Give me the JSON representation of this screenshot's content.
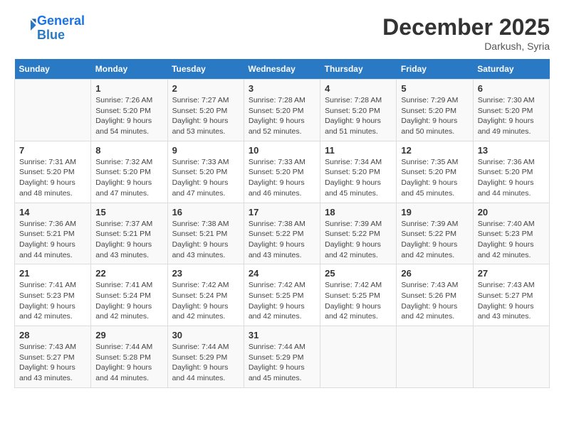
{
  "header": {
    "logo_line1": "General",
    "logo_line2": "Blue",
    "month_title": "December 2025",
    "location": "Darkush, Syria"
  },
  "calendar": {
    "weekdays": [
      "Sunday",
      "Monday",
      "Tuesday",
      "Wednesday",
      "Thursday",
      "Friday",
      "Saturday"
    ],
    "weeks": [
      [
        {
          "day": "",
          "info": ""
        },
        {
          "day": "1",
          "info": "Sunrise: 7:26 AM\nSunset: 5:20 PM\nDaylight: 9 hours\nand 54 minutes."
        },
        {
          "day": "2",
          "info": "Sunrise: 7:27 AM\nSunset: 5:20 PM\nDaylight: 9 hours\nand 53 minutes."
        },
        {
          "day": "3",
          "info": "Sunrise: 7:28 AM\nSunset: 5:20 PM\nDaylight: 9 hours\nand 52 minutes."
        },
        {
          "day": "4",
          "info": "Sunrise: 7:28 AM\nSunset: 5:20 PM\nDaylight: 9 hours\nand 51 minutes."
        },
        {
          "day": "5",
          "info": "Sunrise: 7:29 AM\nSunset: 5:20 PM\nDaylight: 9 hours\nand 50 minutes."
        },
        {
          "day": "6",
          "info": "Sunrise: 7:30 AM\nSunset: 5:20 PM\nDaylight: 9 hours\nand 49 minutes."
        }
      ],
      [
        {
          "day": "7",
          "info": "Sunrise: 7:31 AM\nSunset: 5:20 PM\nDaylight: 9 hours\nand 48 minutes."
        },
        {
          "day": "8",
          "info": "Sunrise: 7:32 AM\nSunset: 5:20 PM\nDaylight: 9 hours\nand 47 minutes."
        },
        {
          "day": "9",
          "info": "Sunrise: 7:33 AM\nSunset: 5:20 PM\nDaylight: 9 hours\nand 47 minutes."
        },
        {
          "day": "10",
          "info": "Sunrise: 7:33 AM\nSunset: 5:20 PM\nDaylight: 9 hours\nand 46 minutes."
        },
        {
          "day": "11",
          "info": "Sunrise: 7:34 AM\nSunset: 5:20 PM\nDaylight: 9 hours\nand 45 minutes."
        },
        {
          "day": "12",
          "info": "Sunrise: 7:35 AM\nSunset: 5:20 PM\nDaylight: 9 hours\nand 45 minutes."
        },
        {
          "day": "13",
          "info": "Sunrise: 7:36 AM\nSunset: 5:20 PM\nDaylight: 9 hours\nand 44 minutes."
        }
      ],
      [
        {
          "day": "14",
          "info": "Sunrise: 7:36 AM\nSunset: 5:21 PM\nDaylight: 9 hours\nand 44 minutes."
        },
        {
          "day": "15",
          "info": "Sunrise: 7:37 AM\nSunset: 5:21 PM\nDaylight: 9 hours\nand 43 minutes."
        },
        {
          "day": "16",
          "info": "Sunrise: 7:38 AM\nSunset: 5:21 PM\nDaylight: 9 hours\nand 43 minutes."
        },
        {
          "day": "17",
          "info": "Sunrise: 7:38 AM\nSunset: 5:22 PM\nDaylight: 9 hours\nand 43 minutes."
        },
        {
          "day": "18",
          "info": "Sunrise: 7:39 AM\nSunset: 5:22 PM\nDaylight: 9 hours\nand 42 minutes."
        },
        {
          "day": "19",
          "info": "Sunrise: 7:39 AM\nSunset: 5:22 PM\nDaylight: 9 hours\nand 42 minutes."
        },
        {
          "day": "20",
          "info": "Sunrise: 7:40 AM\nSunset: 5:23 PM\nDaylight: 9 hours\nand 42 minutes."
        }
      ],
      [
        {
          "day": "21",
          "info": "Sunrise: 7:41 AM\nSunset: 5:23 PM\nDaylight: 9 hours\nand 42 minutes."
        },
        {
          "day": "22",
          "info": "Sunrise: 7:41 AM\nSunset: 5:24 PM\nDaylight: 9 hours\nand 42 minutes."
        },
        {
          "day": "23",
          "info": "Sunrise: 7:42 AM\nSunset: 5:24 PM\nDaylight: 9 hours\nand 42 minutes."
        },
        {
          "day": "24",
          "info": "Sunrise: 7:42 AM\nSunset: 5:25 PM\nDaylight: 9 hours\nand 42 minutes."
        },
        {
          "day": "25",
          "info": "Sunrise: 7:42 AM\nSunset: 5:25 PM\nDaylight: 9 hours\nand 42 minutes."
        },
        {
          "day": "26",
          "info": "Sunrise: 7:43 AM\nSunset: 5:26 PM\nDaylight: 9 hours\nand 42 minutes."
        },
        {
          "day": "27",
          "info": "Sunrise: 7:43 AM\nSunset: 5:27 PM\nDaylight: 9 hours\nand 43 minutes."
        }
      ],
      [
        {
          "day": "28",
          "info": "Sunrise: 7:43 AM\nSunset: 5:27 PM\nDaylight: 9 hours\nand 43 minutes."
        },
        {
          "day": "29",
          "info": "Sunrise: 7:44 AM\nSunset: 5:28 PM\nDaylight: 9 hours\nand 44 minutes."
        },
        {
          "day": "30",
          "info": "Sunrise: 7:44 AM\nSunset: 5:29 PM\nDaylight: 9 hours\nand 44 minutes."
        },
        {
          "day": "31",
          "info": "Sunrise: 7:44 AM\nSunset: 5:29 PM\nDaylight: 9 hours\nand 45 minutes."
        },
        {
          "day": "",
          "info": ""
        },
        {
          "day": "",
          "info": ""
        },
        {
          "day": "",
          "info": ""
        }
      ]
    ]
  }
}
